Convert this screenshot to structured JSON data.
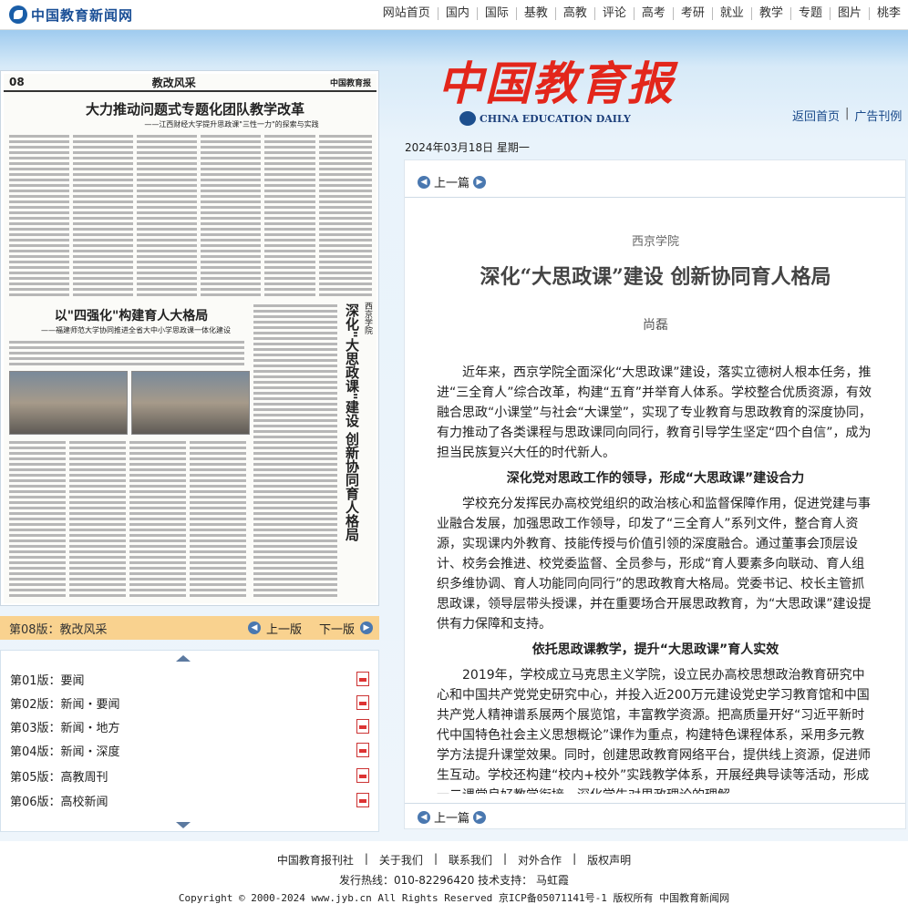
{
  "site": {
    "logo_text": "中国教育新闻网"
  },
  "topnav": [
    "网站首页",
    "国内",
    "国际",
    "基教",
    "高教",
    "评论",
    "高考",
    "考研",
    "就业",
    "教学",
    "专题",
    "图片",
    "桃李"
  ],
  "paper_preview": {
    "page_no": "08",
    "section": "教改风采",
    "masthead": "中国教育报",
    "headline1": "大力推动问题式专题化团队教学改革",
    "subhead1": "——江西财经大学提升思政课\"三性一力\"的探索与实践",
    "headline2": "以\"四强化\"构建育人大格局",
    "subhead2": "——福建师范大学协同推进全省大中小学思政课一体化建设",
    "vertical_title": "深化\"大思政课\"建设 创新协同育人格局",
    "vertical_sub": "西京学院"
  },
  "page_nav": {
    "current": "第08版：教改风采",
    "prev": "上一版",
    "next": "下一版"
  },
  "page_list": [
    {
      "label": "第01版：要闻"
    },
    {
      "label": "第02版：新闻・要闻"
    },
    {
      "label": "第03版：新闻・地方"
    },
    {
      "label": "第04版：新闻・深度"
    },
    {
      "label": "第05版：高教周刊"
    },
    {
      "label": "第06版：高校新闻"
    }
  ],
  "masthead": {
    "title_cn": "中国教育报",
    "title_en": "CHINA EDUCATION DAILY"
  },
  "header_links": {
    "home": "返回首页",
    "ads": "广告刊例"
  },
  "date_line": "2024年03月18日  星期一",
  "article": {
    "nav_prev": "上一篇",
    "kicker": "西京学院",
    "title": "深化“大思政课”建设 创新协同育人格局",
    "author": "尚磊",
    "p1": "近年来，西京学院全面深化“大思政课”建设，落实立德树人根本任务，推进“三全育人”综合改革，构建“五育”并举育人体系。学校整合优质资源，有效融合思政“小课堂”与社会“大课堂”，实现了专业教育与思政教育的深度协同，有力推动了各类课程与思政课同向同行，教育引导学生坚定“四个自信”，成为担当民族复兴大任的时代新人。",
    "h1": "深化党对思政工作的领导，形成“大思政课”建设合力",
    "p2": "学校充分发挥民办高校党组织的政治核心和监督保障作用，促进党建与事业融合发展，加强思政工作领导，印发了“三全育人”系列文件，整合育人资源，实现课内外教育、技能传授与价值引领的深度融合。通过董事会顶层设计、校务会推进、校党委监督、全员参与，形成“育人要素多向联动、育人组织多维协调、育人功能同向同行”的思政教育大格局。党委书记、校长主管抓思政课，领导层带头授课，并在重要场合开展思政教育，为“大思政课”建设提供有力保障和支持。",
    "h2": "依托思政课教学，提升“大思政课”育人实效",
    "p3": "2019年，学校成立马克思主义学院，设立民办高校思想政治教育研究中心和中国共产党党史研究中心，并投入近200万元建设党史学习教育馆和中国共产党人精神谱系展两个展览馆，丰富教学资源。把高质量开好“习近平新时代中国特色社会主义思想概论”课作为重点，构建特色课程体系，采用多元教学方法提升课堂效果。同时，创建思政教育网络平台，提供线上资源，促进师生互动。学校还构建“校内+校外”实践教学体系，开展经典导读等活动，形成一二课堂良好教学衔接，深化学生对思政理论的理解。"
  },
  "footer": {
    "links": [
      "中国教育报刊社",
      "关于我们",
      "联系我们",
      "对外合作",
      "版权声明"
    ],
    "hotline": "发行热线：010-82296420  技术支持： 马虹霞",
    "copyright": "Copyright © 2000-2024 www.jyb.cn All Rights Reserved 京ICP备05071141号-1 版权所有 中国教育新闻网"
  }
}
